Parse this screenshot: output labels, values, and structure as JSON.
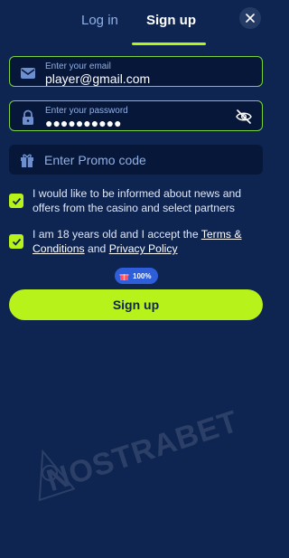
{
  "tabs": [
    {
      "label": "Log in",
      "active": false
    },
    {
      "label": "Sign up",
      "active": true
    }
  ],
  "close_icon": "close-icon",
  "email": {
    "label": "Enter your email",
    "value": "player@gmail.com",
    "icon": "envelope-icon"
  },
  "password": {
    "label": "Enter your password",
    "value": "●●●●●●●●●●",
    "icon": "lock-icon",
    "toggle_icon": "eye-off-icon"
  },
  "promo": {
    "placeholder": "Enter Promo code",
    "icon": "gift-icon"
  },
  "checkbox_news": {
    "checked": true,
    "text": "I would like to be informed about news and offers from the casino and select partners"
  },
  "checkbox_terms": {
    "checked": true,
    "text_before": "I am 18 years old and I accept the ",
    "terms_link": "Terms & Conditions",
    "text_middle": " and ",
    "privacy_link": "Privacy Policy"
  },
  "bonus_badge": {
    "text": "100%",
    "icon": "gift-box-icon"
  },
  "signup_button": "Sign up",
  "watermark": "NOSTRABET",
  "colors": {
    "background": "#0e2451",
    "accent": "#b7f21b",
    "field": "#07173a",
    "muted": "#8fb0e6"
  }
}
